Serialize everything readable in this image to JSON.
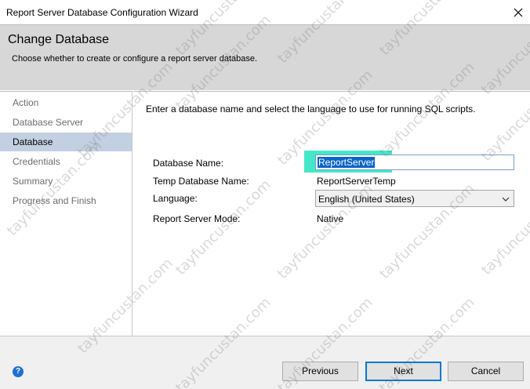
{
  "window": {
    "title": "Report Server Database Configuration Wizard",
    "close_icon": "close-icon"
  },
  "header": {
    "heading": "Change Database",
    "subtitle": "Choose whether to create or configure a report server database."
  },
  "sidebar": {
    "items": [
      {
        "label": "Action",
        "active": false
      },
      {
        "label": "Database Server",
        "active": false
      },
      {
        "label": "Database",
        "active": true
      },
      {
        "label": "Credentials",
        "active": false
      },
      {
        "label": "Summary",
        "active": false
      },
      {
        "label": "Progress and Finish",
        "active": false
      }
    ]
  },
  "content": {
    "instructions": "Enter a database name and select the language to use for running SQL scripts.",
    "fields": {
      "database_name": {
        "label": "Database Name:",
        "value": "ReportServer"
      },
      "temp_database_name": {
        "label": "Temp Database Name:",
        "value": "ReportServerTemp"
      },
      "language": {
        "label": "Language:",
        "value": "English (United States)"
      },
      "report_server_mode": {
        "label": "Report Server Mode:",
        "value": "Native"
      }
    }
  },
  "footer": {
    "help_icon": "help-icon",
    "previous_label": "Previous",
    "next_label": "Next",
    "cancel_label": "Cancel"
  },
  "watermark": "tayfuncustan.com",
  "colors": {
    "header_bg": "#d7d7d7",
    "selected_nav": "#c3d0e2",
    "highlight": "#22e4c0",
    "text_selection": "#0a64c8",
    "primary_border": "#0078d7"
  }
}
